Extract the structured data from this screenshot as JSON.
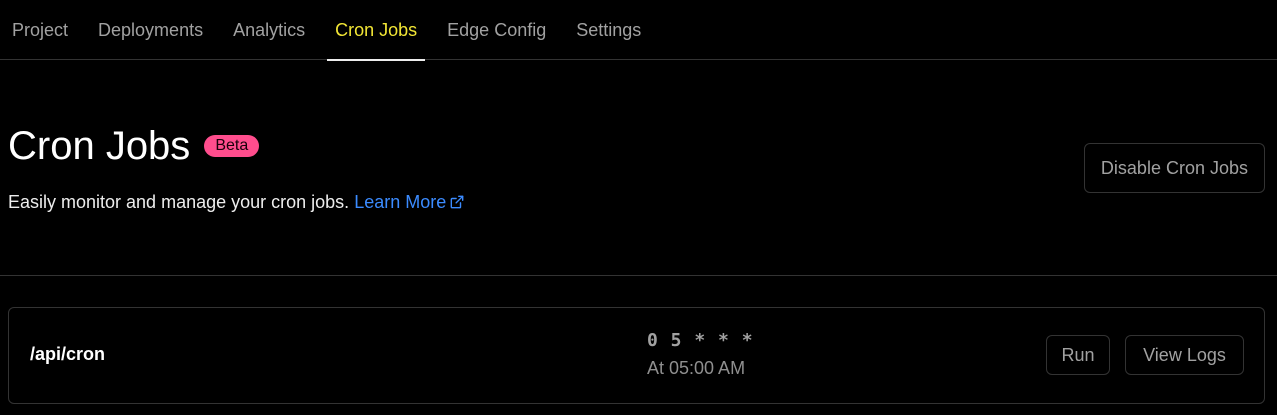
{
  "tabs": [
    {
      "label": "Project",
      "active": false
    },
    {
      "label": "Deployments",
      "active": false
    },
    {
      "label": "Analytics",
      "active": false
    },
    {
      "label": "Cron Jobs",
      "active": true
    },
    {
      "label": "Edge Config",
      "active": false
    },
    {
      "label": "Settings",
      "active": false
    }
  ],
  "header": {
    "title": "Cron Jobs",
    "badge": "Beta",
    "subtitle": "Easily monitor and manage your cron jobs.",
    "learn_more": "Learn More",
    "disable_button": "Disable Cron Jobs"
  },
  "cron_jobs": [
    {
      "path": "/api/cron",
      "expression": "0 5 * * *",
      "description": "At 05:00 AM",
      "run_label": "Run",
      "logs_label": "View Logs"
    }
  ],
  "colors": {
    "background": "#000000",
    "active_tab": "#f2e635",
    "badge": "#ff4d8d",
    "link": "#3b8bff",
    "border": "#333333"
  },
  "icons": {
    "learn_more": "external-link-icon"
  }
}
